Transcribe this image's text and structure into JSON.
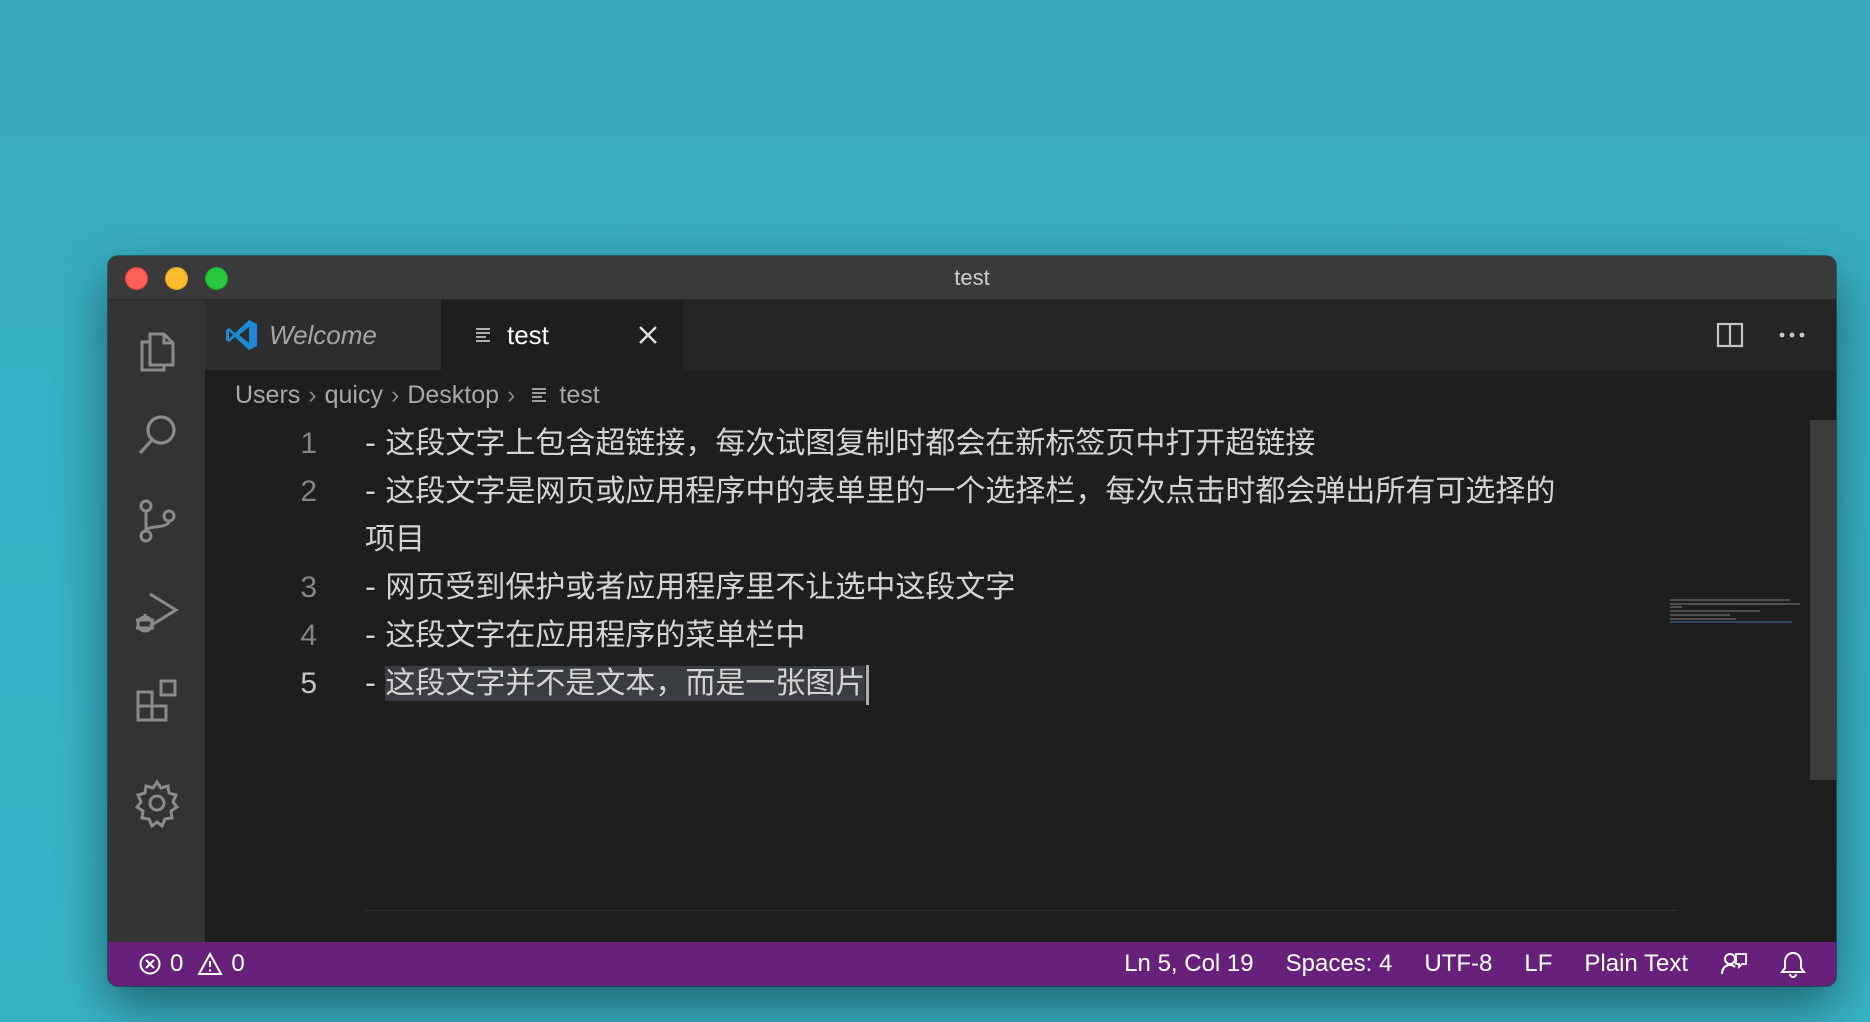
{
  "window": {
    "title": "test"
  },
  "tabs": [
    {
      "label": "Welcome",
      "icon": "vscode-logo-icon"
    },
    {
      "label": "test",
      "icon": "text-file-icon"
    }
  ],
  "breadcrumb": [
    "Users",
    "quicy",
    "Desktop",
    "test"
  ],
  "editor": {
    "lines": [
      {
        "number": "1",
        "text": "- 这段文字上包含超链接，每次试图复制时都会在新标签页中打开超链接"
      },
      {
        "number": "2",
        "text": "- 这段文字是网页或应用程序中的表单里的一个选择栏，每次点击时都会弹出所有可选择的",
        "wrap": "项目"
      },
      {
        "number": "3",
        "text": "- 网页受到保护或者应用程序里不让选中这段文字"
      },
      {
        "number": "4",
        "text": "- 这段文字在应用程序的菜单栏中"
      },
      {
        "number": "5",
        "prefix": "- ",
        "selected": "这段文字并不是文本，而是一张图片"
      }
    ]
  },
  "statusbar": {
    "errors": "0",
    "warnings": "0",
    "position": "Ln 5, Col 19",
    "spaces": "Spaces: 4",
    "encoding": "UTF-8",
    "eol": "LF",
    "language": "Plain Text"
  },
  "colors": {
    "statusbar": "#68217a",
    "editor_bg": "#1e1e1e",
    "activitybar_bg": "#333333"
  }
}
